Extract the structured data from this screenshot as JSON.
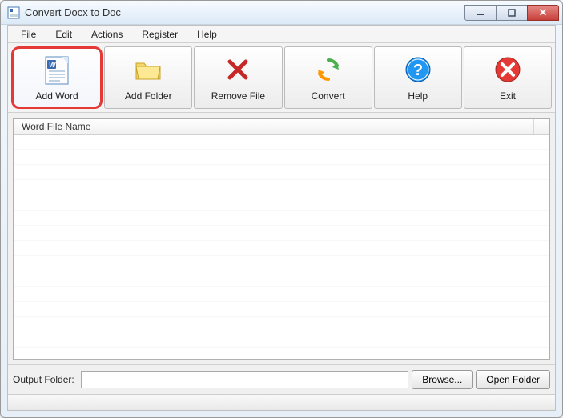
{
  "window": {
    "title": "Convert Docx to Doc"
  },
  "menu": {
    "items": [
      "File",
      "Edit",
      "Actions",
      "Register",
      "Help"
    ]
  },
  "toolbar": {
    "add_word": "Add Word",
    "add_folder": "Add Folder",
    "remove_file": "Remove File",
    "convert": "Convert",
    "help": "Help",
    "exit": "Exit"
  },
  "list": {
    "column_header": "Word File Name",
    "rows": []
  },
  "output": {
    "label": "Output Folder:",
    "value": "",
    "browse": "Browse...",
    "open_folder": "Open Folder"
  },
  "colors": {
    "highlight_border": "#e53935",
    "close_btn": "#c7403a"
  },
  "icons": {
    "app": "word-doc",
    "add_word": "word-document-icon",
    "add_folder": "folder-icon",
    "remove_file": "x-icon",
    "convert": "refresh-arrows-icon",
    "help": "question-circle-icon",
    "exit": "x-circle-icon"
  }
}
